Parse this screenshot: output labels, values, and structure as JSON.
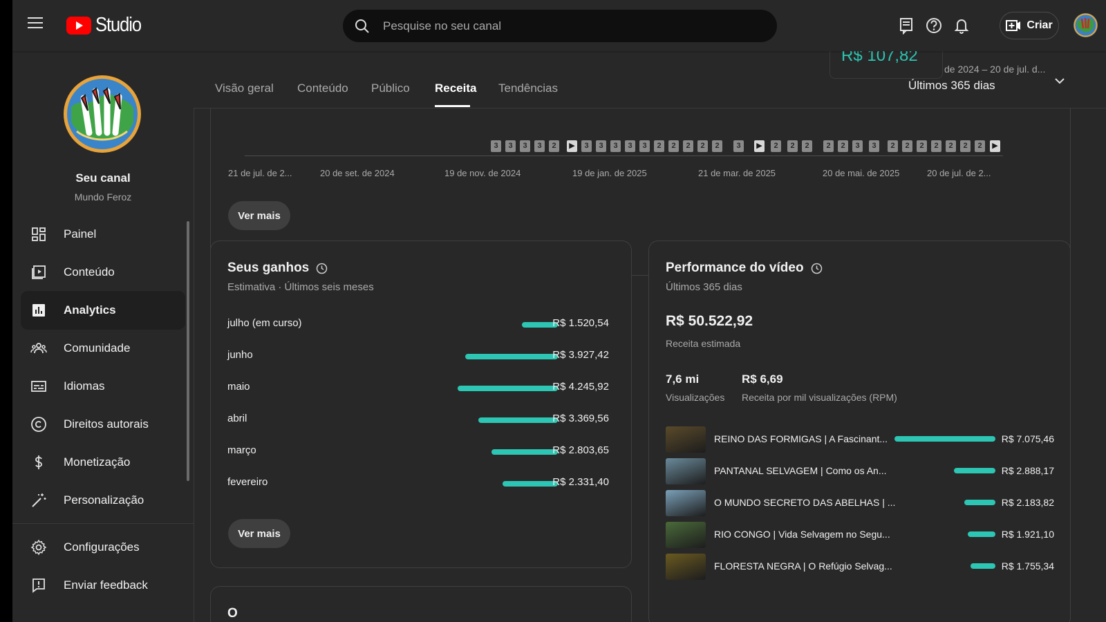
{
  "app": {
    "logo_text": "Studio",
    "search_placeholder": "Pesquise no seu canal",
    "create_label": "Criar"
  },
  "channel": {
    "title": "Seu canal",
    "name": "Mundo Feroz"
  },
  "sidebar": {
    "items": [
      {
        "label": "Painel",
        "icon": "dashboard-icon"
      },
      {
        "label": "Conteúdo",
        "icon": "content-icon"
      },
      {
        "label": "Analytics",
        "icon": "analytics-icon",
        "active": true
      },
      {
        "label": "Comunidade",
        "icon": "community-icon"
      },
      {
        "label": "Idiomas",
        "icon": "subtitles-icon"
      },
      {
        "label": "Direitos autorais",
        "icon": "copyright-icon"
      },
      {
        "label": "Monetização",
        "icon": "dollar-icon"
      },
      {
        "label": "Personalização",
        "icon": "magic-wand-icon"
      }
    ],
    "footer": [
      {
        "label": "Configurações",
        "icon": "gear-icon"
      },
      {
        "label": "Enviar feedback",
        "icon": "feedback-icon"
      }
    ]
  },
  "tabs": [
    {
      "label": "Visão geral"
    },
    {
      "label": "Conteúdo"
    },
    {
      "label": "Público"
    },
    {
      "label": "Receita",
      "active": true
    },
    {
      "label": "Tendências"
    }
  ],
  "date_range": {
    "label": "de 2024 – 20 de jul. d...",
    "value": "Últimos 365 dias"
  },
  "floating_revenue": "R$ 107,82",
  "timeline": {
    "markers": [
      "3",
      "3",
      "3",
      "3",
      "2",
      "▶",
      "3",
      "3",
      "3",
      "3",
      "3",
      "2",
      "2",
      "2",
      "2",
      "2",
      "3",
      "▶",
      "2",
      "2",
      "2",
      "2",
      "2",
      "3",
      "3",
      "2",
      "2",
      "2",
      "2",
      "2",
      "2",
      "2",
      "▶"
    ],
    "ticks": [
      "21 de jul. de 2...",
      "20 de set. de 2024",
      "19 de nov. de 2024",
      "19 de jan. de 2025",
      "21 de mar. de 2025",
      "20 de mai. de 2025",
      "20 de jul. de 2..."
    ],
    "see_more": "Ver mais"
  },
  "earnings": {
    "title": "Seus ganhos",
    "subtitle": "Estimativa · Últimos seis meses",
    "see_more": "Ver mais",
    "rows": [
      {
        "label": "julho (em curso)",
        "value": "R$ 1.520,54",
        "amount": 1520.54
      },
      {
        "label": "junho",
        "value": "R$ 3.927,42",
        "amount": 3927.42
      },
      {
        "label": "maio",
        "value": "R$ 4.245,92",
        "amount": 4245.92
      },
      {
        "label": "abril",
        "value": "R$ 3.369,56",
        "amount": 3369.56
      },
      {
        "label": "março",
        "value": "R$ 2.803,65",
        "amount": 2803.65
      },
      {
        "label": "fevereiro",
        "value": "R$ 2.331,40",
        "amount": 2331.4
      }
    ]
  },
  "performance": {
    "title": "Performance do vídeo",
    "subtitle": "Últimos 365 dias",
    "total": "R$ 50.522,92",
    "total_label": "Receita estimada",
    "views_value": "7,6 mi",
    "views_label": "Visualizações",
    "rpm_value": "R$ 6,69",
    "rpm_label": "Receita por mil visualizações (RPM)",
    "videos": [
      {
        "title": "REINO DAS FORMIGAS | A Fascinant...",
        "value": "R$ 7.075,46",
        "amount": 7075.46,
        "thumb_color": "#5a4a2a"
      },
      {
        "title": "PANTANAL SELVAGEM | Como os An...",
        "value": "R$ 2.888,17",
        "amount": 2888.17,
        "thumb_color": "#6a8a9a"
      },
      {
        "title": "O MUNDO SECRETO DAS ABELHAS | ...",
        "value": "R$ 2.183,82",
        "amount": 2183.82,
        "thumb_color": "#7aa0b8"
      },
      {
        "title": "RIO CONGO | Vida Selvagem no Segu...",
        "value": "R$ 1.921,10",
        "amount": 1921.1,
        "thumb_color": "#4a6a3a"
      },
      {
        "title": "FLORESTA NEGRA | O Refúgio Selvag...",
        "value": "R$ 1.755,34",
        "amount": 1755.34,
        "thumb_color": "#6a5a20"
      }
    ]
  },
  "bottom_card_title": "O",
  "colors": {
    "accent": "#2dc5b3",
    "background": "#282828",
    "youtube_red": "#ff0000"
  }
}
